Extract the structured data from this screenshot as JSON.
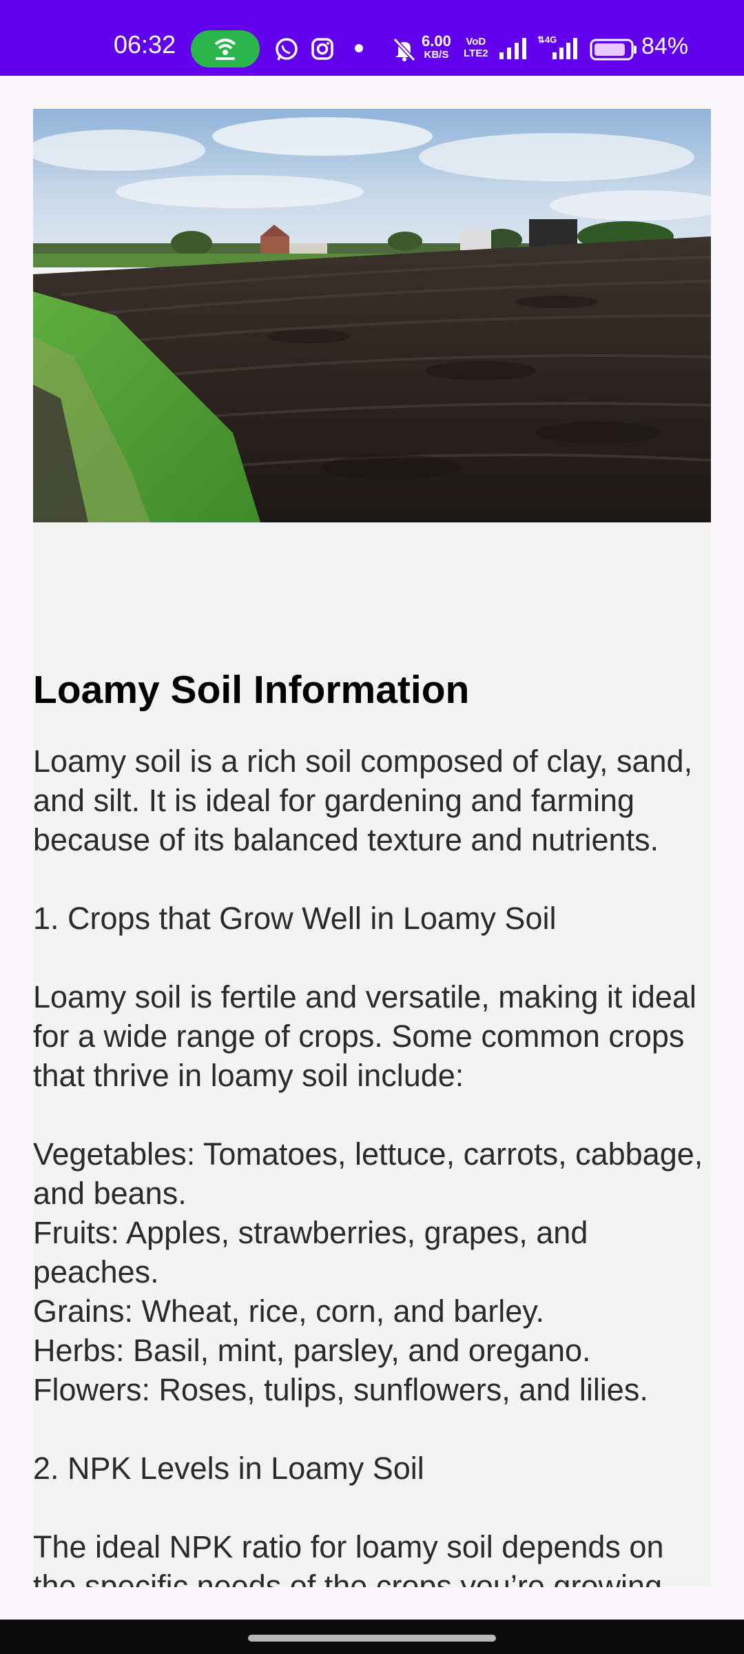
{
  "status_bar": {
    "time": "06:32",
    "net_speed_value": "6.00",
    "net_speed_unit": "KB/S",
    "volte_top": "VoD",
    "volte_bottom": "LTE2",
    "battery_percent": "84%",
    "colors": {
      "background": "#6200ee",
      "hotspot": "#2bb64c"
    }
  },
  "page": {
    "title": "Loamy Soil Information",
    "intro": "Loamy soil is a rich soil composed of clay, sand, and silt. It is ideal for gardening and farming because of its balanced texture and nutrients.",
    "section1_heading": "1. Crops that Grow Well in Loamy Soil",
    "section1_text": "Loamy soil is fertile and versatile, making it ideal for a wide range of crops. Some common crops that thrive in loamy soil include:",
    "crops": [
      "Vegetables: Tomatoes, lettuce, carrots, cabbage, and beans.",
      "Fruits: Apples, strawberries, grapes, and peaches.",
      "Grains: Wheat, rice, corn, and barley.",
      "Herbs: Basil, mint, parsley, and oregano.",
      "Flowers: Roses, tulips, sunflowers, and lilies."
    ],
    "section2_heading": "2. NPK Levels in Loamy Soil",
    "section2_text": "The ideal NPK ratio for loamy soil depends on the specific needs of the crops you’re growing. Typically, loamy soil has a balanced"
  }
}
